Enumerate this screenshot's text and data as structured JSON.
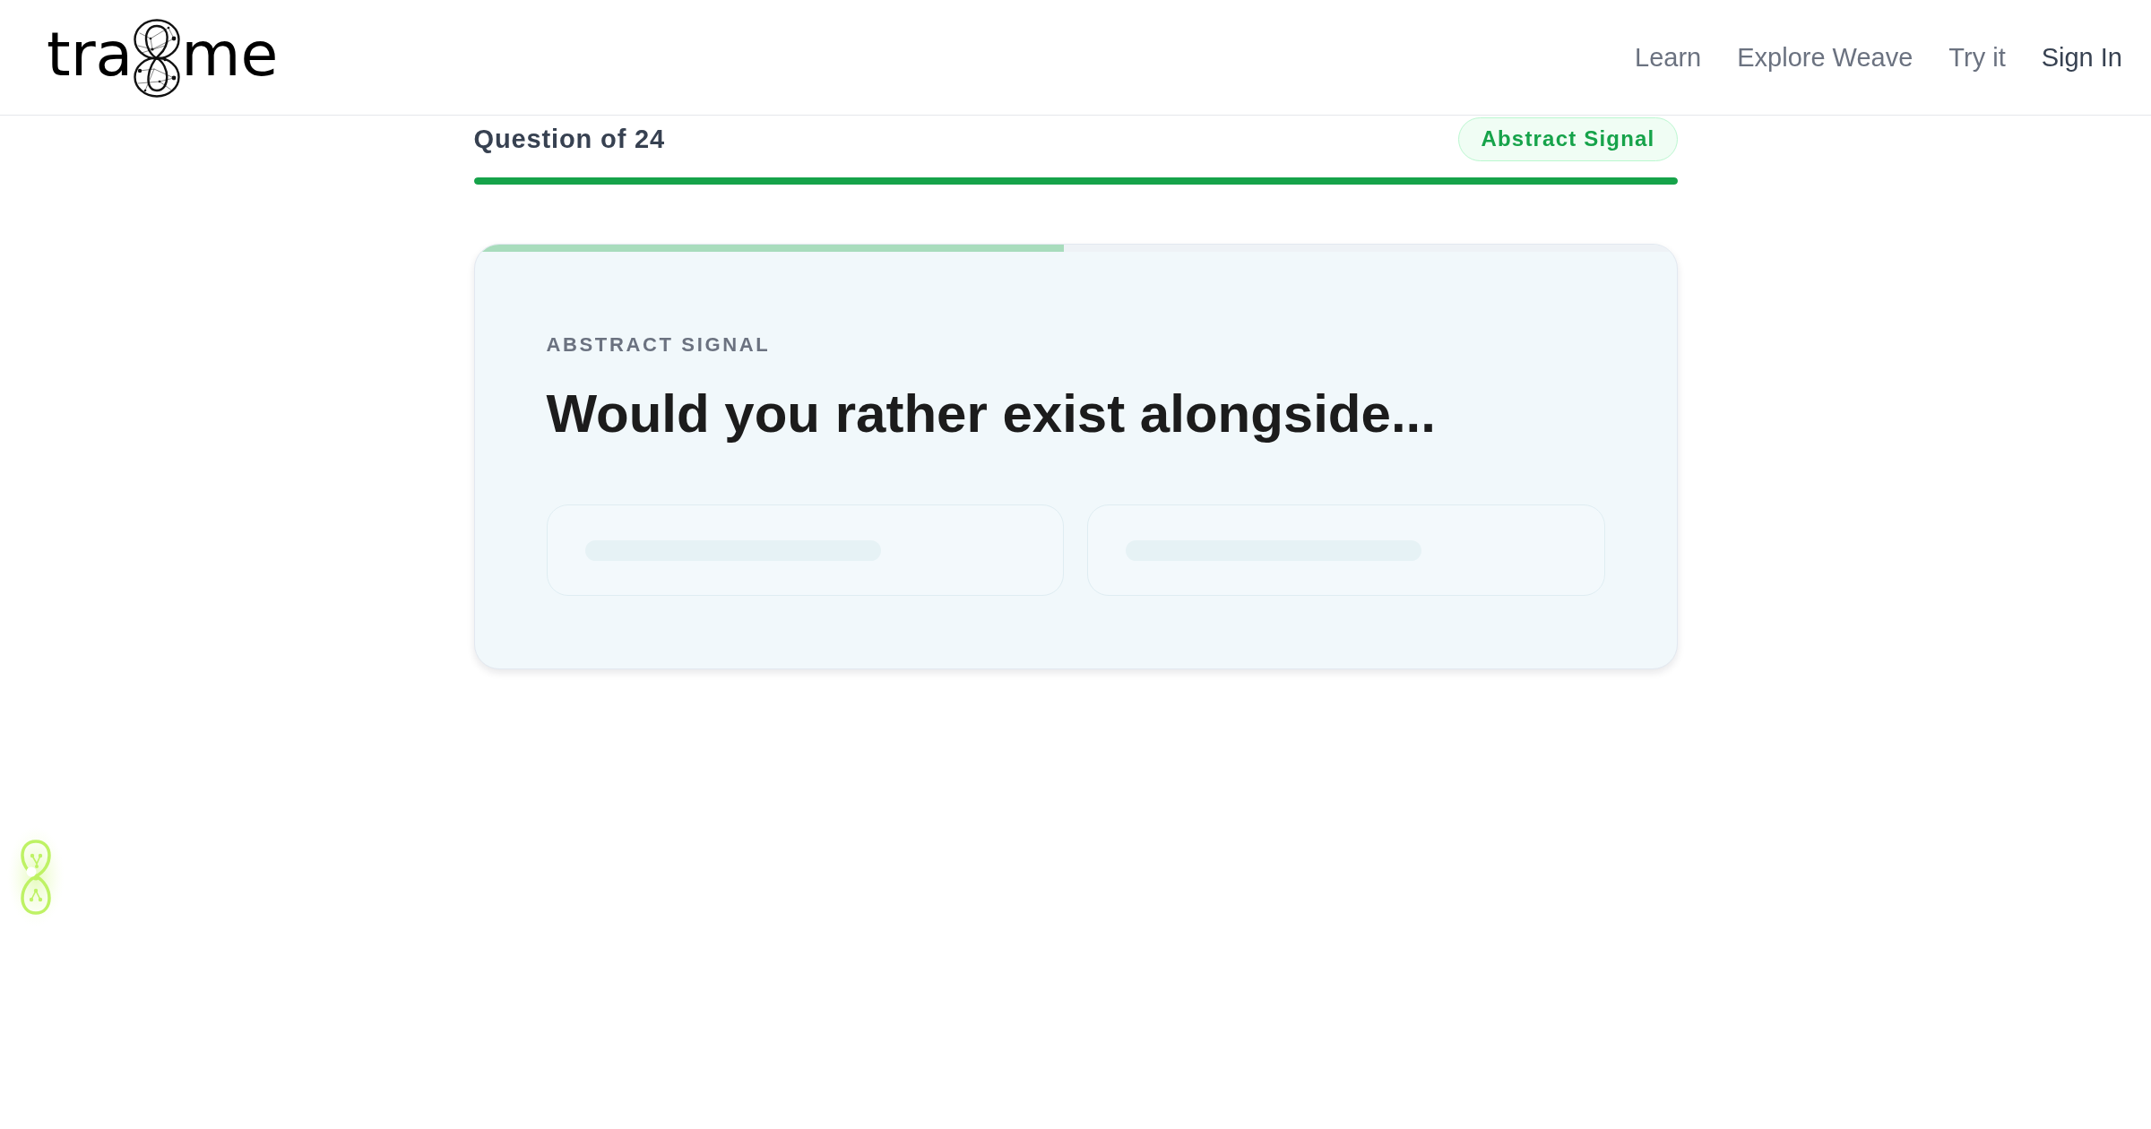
{
  "header": {
    "logo": {
      "prefix": "tra",
      "suffix": "me"
    },
    "nav": [
      {
        "label": "Learn",
        "kind": "link"
      },
      {
        "label": "Explore Weave",
        "kind": "link"
      },
      {
        "label": "Try it",
        "kind": "link"
      },
      {
        "label": "Sign In",
        "kind": "account"
      }
    ]
  },
  "quiz": {
    "counter": "Question of 24",
    "category_badge": "Abstract Signal",
    "progress": {
      "level": 1
    }
  },
  "card": {
    "progress": {
      "level": 0.49
    },
    "eyebrow": "ABSTRACT SIGNAL",
    "question": "Would you rather exist alongside...",
    "options": [
      {
        "loading": true
      },
      {
        "loading": true
      }
    ]
  }
}
